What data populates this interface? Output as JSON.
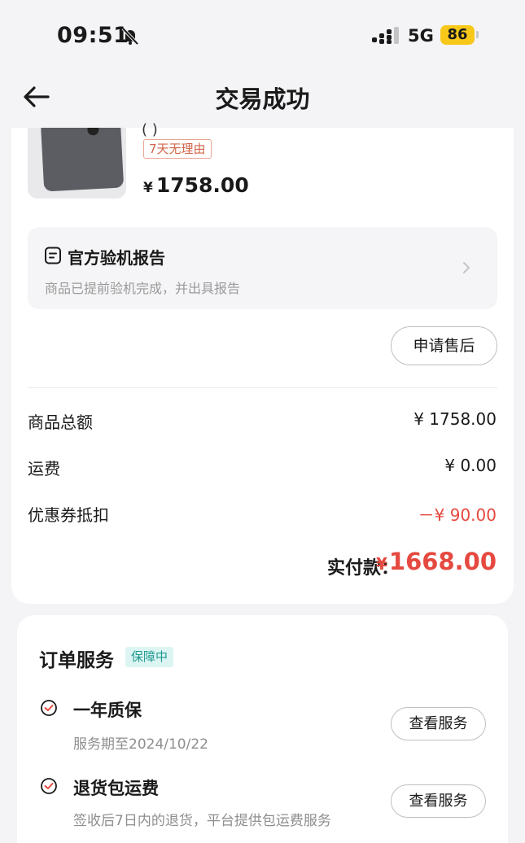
{
  "status_bar": {
    "time": "09:51",
    "network": "5G",
    "battery": "86"
  },
  "nav": {
    "title": "交易成功"
  },
  "product": {
    "title_fragment": "( )",
    "tag": "7天无理由",
    "price_symbol": "¥",
    "price": "1758.00"
  },
  "inspection": {
    "title": "官方验机报告",
    "subtitle": "商品已提前验机完成，并出具报告"
  },
  "after_sale_button": "申请售后",
  "summary": {
    "rows": [
      {
        "label": "商品总额",
        "value": "¥ 1758.00"
      },
      {
        "label": "运费",
        "value": "¥ 0.00"
      },
      {
        "label": "优惠券抵扣",
        "value": "－¥ 90.00"
      }
    ],
    "paid_label": "实付款：",
    "paid_symbol": "¥",
    "paid_value": "1668.00"
  },
  "service": {
    "title": "订单服务",
    "badge": "保障中",
    "items": [
      {
        "name": "一年质保",
        "desc": "服务期至2024/10/22",
        "button": "查看服务"
      },
      {
        "name": "退货包运费",
        "desc": "签收后7日内的退货，平台提供包运费服务",
        "button": "查看服务"
      }
    ]
  },
  "colors": {
    "accent_red": "#e5493f",
    "badge_teal": "#229a90",
    "battery_yellow": "#f7c81a"
  },
  "icons": [
    "bell-slash-icon",
    "signal-icon",
    "back-arrow-icon",
    "document-icon",
    "chevron-right-icon",
    "check-circle-icon"
  ]
}
